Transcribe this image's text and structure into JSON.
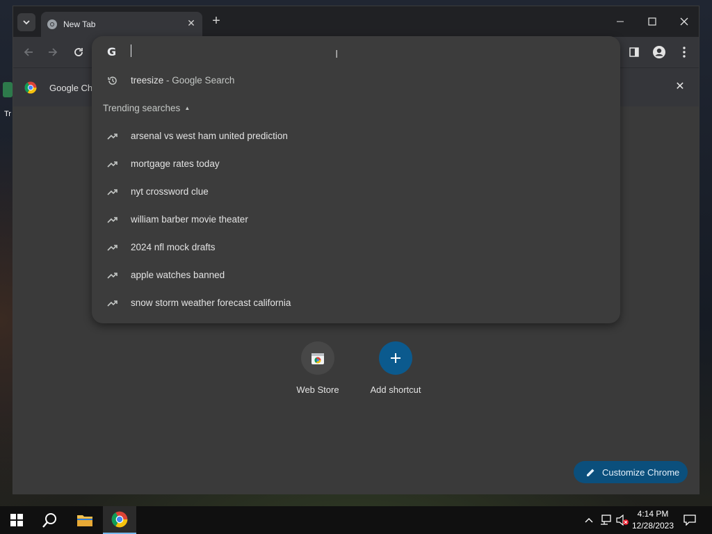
{
  "tab": {
    "title": "New Tab"
  },
  "infobar": {
    "text": "Google Ch"
  },
  "desktop": {
    "icon_label": "Tr"
  },
  "omnibox": {
    "history": {
      "query": "treesize",
      "suffix": " - Google Search"
    },
    "trending_header": "Trending searches",
    "trending": [
      "arsenal vs west ham united prediction",
      "mortgage rates today",
      "nyt crossword clue",
      "william barber movie theater",
      "2024 nfl mock drafts",
      "apple watches banned",
      "snow storm weather forecast california"
    ]
  },
  "shortcuts": [
    {
      "label": "Web Store"
    },
    {
      "label": "Add shortcut"
    }
  ],
  "customize": {
    "label": "Customize Chrome"
  },
  "clock": {
    "time": "4:14 PM",
    "date": "12/28/2023"
  },
  "colors": {
    "accent": "#0b4f7c",
    "add_shortcut": "#0b5a8e"
  }
}
